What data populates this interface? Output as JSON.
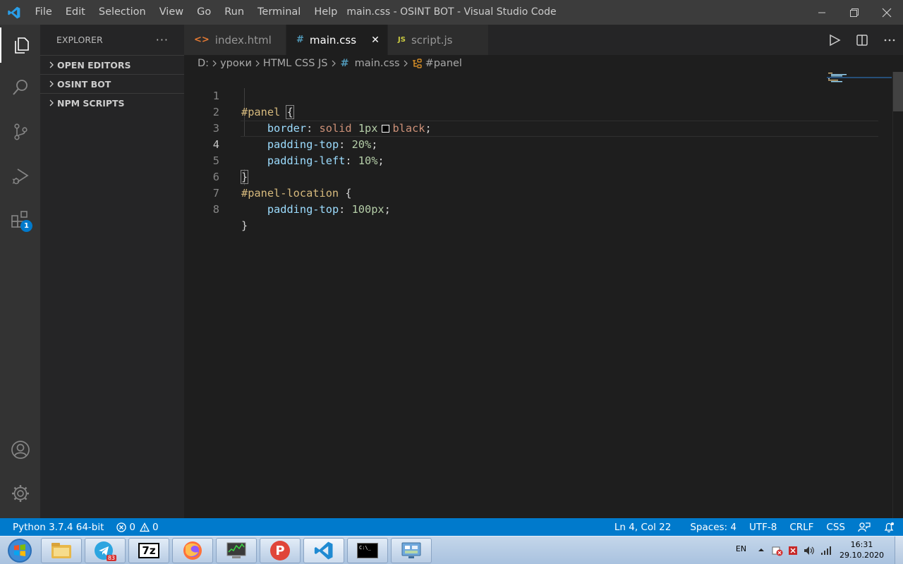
{
  "window": {
    "title": "main.css - OSINT BOT - Visual Studio Code",
    "menu": [
      "File",
      "Edit",
      "Selection",
      "View",
      "Go",
      "Run",
      "Terminal",
      "Help"
    ]
  },
  "activity_bar": {
    "items": [
      "files-icon",
      "search-icon",
      "source-control-icon",
      "run-debug-icon",
      "extensions-icon"
    ],
    "extensions_badge": "1",
    "bottom": [
      "account-icon",
      "settings-gear-icon"
    ]
  },
  "sidebar": {
    "title": "EXPLORER",
    "more": "···",
    "sections": [
      "OPEN EDITORS",
      "OSINT BOT",
      "NPM SCRIPTS"
    ]
  },
  "tabs": [
    {
      "icon": "<>",
      "label": "index.html",
      "active": false
    },
    {
      "icon": "#",
      "label": "main.css",
      "active": true
    },
    {
      "icon": "JS",
      "label": "script.js",
      "active": false
    }
  ],
  "breadcrumb": {
    "items": [
      "D:",
      "уроки",
      "HTML CSS JS",
      "main.css",
      "#panel"
    ]
  },
  "editor": {
    "line_numbers": [
      "1",
      "2",
      "3",
      "4",
      "5",
      "6",
      "7",
      "8"
    ],
    "lines": {
      "l1_selector": "#panel",
      "l1_brace": "{",
      "l2_prop": "border",
      "l2_colon": ": ",
      "l2_val1": "solid",
      "l2_num": "1px",
      "l2_val2": "black",
      "l2_semi": ";",
      "l3_prop": "padding-top",
      "l3_colon": ": ",
      "l3_num": "20%",
      "l3_semi": ";",
      "l4_prop": "padding-left",
      "l4_colon": ": ",
      "l4_num": "10%",
      "l4_semi": ";",
      "l5_brace": "}",
      "l6_selector": "#panel-location",
      "l6_brace": "{",
      "l7_prop": "padding-top",
      "l7_colon": ": ",
      "l7_num": "100px",
      "l7_semi": ";",
      "l8_brace": "}"
    },
    "current_line": 4
  },
  "statusbar": {
    "python": "Python 3.7.4 64-bit",
    "errors": "0",
    "warnings": "0",
    "position": "Ln 4, Col 22",
    "spaces": "Spaces: 4",
    "encoding": "UTF-8",
    "eol": "CRLF",
    "language": "CSS"
  },
  "taskbar": {
    "apps": [
      "file-explorer-icon",
      "telegram-icon",
      "7zip-icon",
      "firefox-icon",
      "task-manager-icon",
      "pycharm-like-p-icon",
      "vscode-icon",
      "cmd-icon",
      "control-panel-icon"
    ],
    "telegram_badge": "83",
    "sevenzip_label": "7z",
    "p_label": "P",
    "cmd_label": "C:\\_",
    "lang": "EN",
    "time": "16:31",
    "date": "29.10.2020"
  },
  "colors": {
    "accent": "#007acc",
    "selector": "#d7ba7d",
    "property": "#9cdcfe",
    "value": "#ce9178",
    "number": "#b5cea8"
  }
}
